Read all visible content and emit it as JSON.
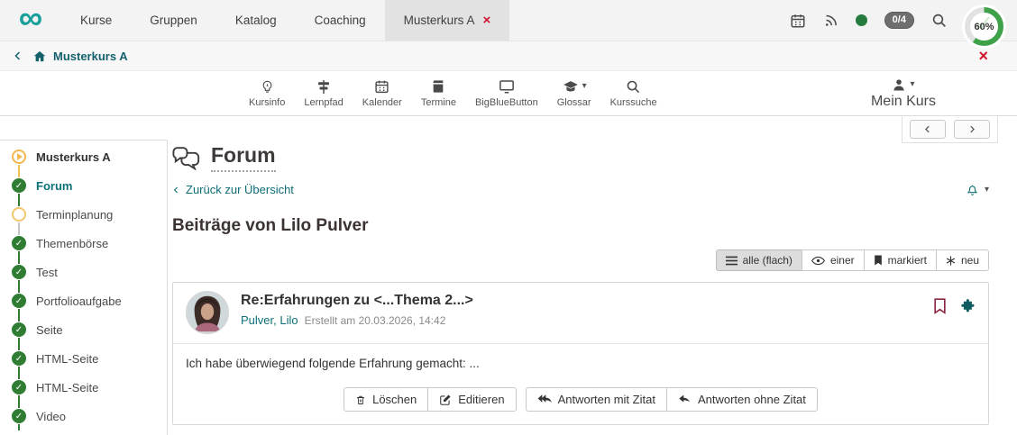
{
  "icons": {
    "infinity": "∞",
    "close": "×",
    "caret_down": "▾",
    "check": "✓"
  },
  "navbar": {
    "tabs": [
      "Kurse",
      "Gruppen",
      "Katalog",
      "Coaching"
    ],
    "course_tab": "Musterkurs A",
    "badge": "0/4"
  },
  "breadcrumb": {
    "label": "Musterkurs A"
  },
  "toolbar": {
    "items": [
      "Kursinfo",
      "Lernpfad",
      "Kalender",
      "Termine",
      "BigBlueButton",
      "Glossar",
      "Kurssuche"
    ],
    "mein_kurs": "Mein Kurs",
    "progress": "60%"
  },
  "sidebar": {
    "items": [
      "Musterkurs A",
      "Forum",
      "Terminplanung",
      "Themenbörse",
      "Test",
      "Portfolioaufgabe",
      "Seite",
      "HTML-Seite",
      "HTML-Seite",
      "Video"
    ]
  },
  "main": {
    "title": "Forum",
    "back_link": "Zurück zur Übersicht",
    "heading": "Beiträge von Lilo Pulver",
    "filters": [
      "alle (flach)",
      "einer",
      "markiert",
      "neu"
    ],
    "post": {
      "title": "Re:Erfahrungen zu <...Thema 2...>",
      "author": "Pulver, Lilo",
      "created": "Erstellt am 20.03.2026, 14:42",
      "body": "Ich habe überwiegend folgende Erfahrung gemacht: ...",
      "actions": [
        "Löschen",
        "Editieren",
        "Antworten mit Zitat",
        "Antworten ohne Zitat"
      ]
    }
  },
  "colors": {
    "brand_teal": "#19a09a",
    "link_teal": "#0d6e75",
    "close_red": "#d0122d",
    "done_green": "#2e7d32",
    "progress_green": "#3fa24a",
    "pending_amber": "#f0b84f",
    "bookmark_maroon": "#8d2741"
  }
}
